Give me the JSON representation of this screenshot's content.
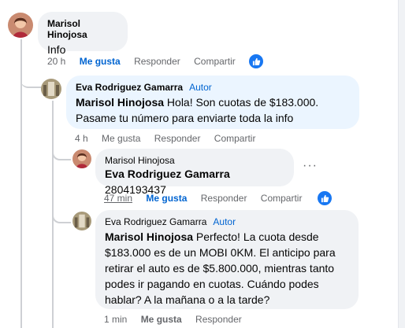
{
  "comments": [
    {
      "name": "Marisol Hinojosa",
      "text": "Info",
      "time": "20 h",
      "like": "Me gusta",
      "reply": "Responder",
      "share": "Compartir"
    },
    {
      "name": "Eva Rodriguez Gamarra",
      "badge": "Autor",
      "mention": "Marisol Hinojosa",
      "text": " Hola! Son cuotas de $183.000. Pasame tu número para enviarte toda la info",
      "time": "4 h",
      "like": "Me gusta",
      "reply": "Responder",
      "share": "Compartir"
    },
    {
      "name": "Marisol Hinojosa",
      "mention": "Eva Rodriguez Gamarra",
      "text": " 2804193437",
      "time": "47 min",
      "like": "Me gusta",
      "reply": "Responder",
      "share": "Compartir",
      "more": "···"
    },
    {
      "name": "Eva Rodriguez Gamarra",
      "badge": "Autor",
      "mention": "Marisol Hinojosa",
      "text": " Perfecto! La cuota desde $183.000 es de un MOBI 0KM. El anticipo para retirar el auto es de $5.800.000, mientras tanto podes ir pagando en cuotas. Cuándo podes hablar? A la mañana o a la tarde?",
      "time": "1 min",
      "like": "Me gusta",
      "reply": "Responder"
    }
  ],
  "icons": {
    "reaction": "thumbs-up-icon",
    "more": "more-options-icon"
  },
  "colors": {
    "like": "#0064d1",
    "reaction": "#1877f2",
    "bubble": "#f0f2f5",
    "bubble_highlight": "#ebf5ff"
  }
}
